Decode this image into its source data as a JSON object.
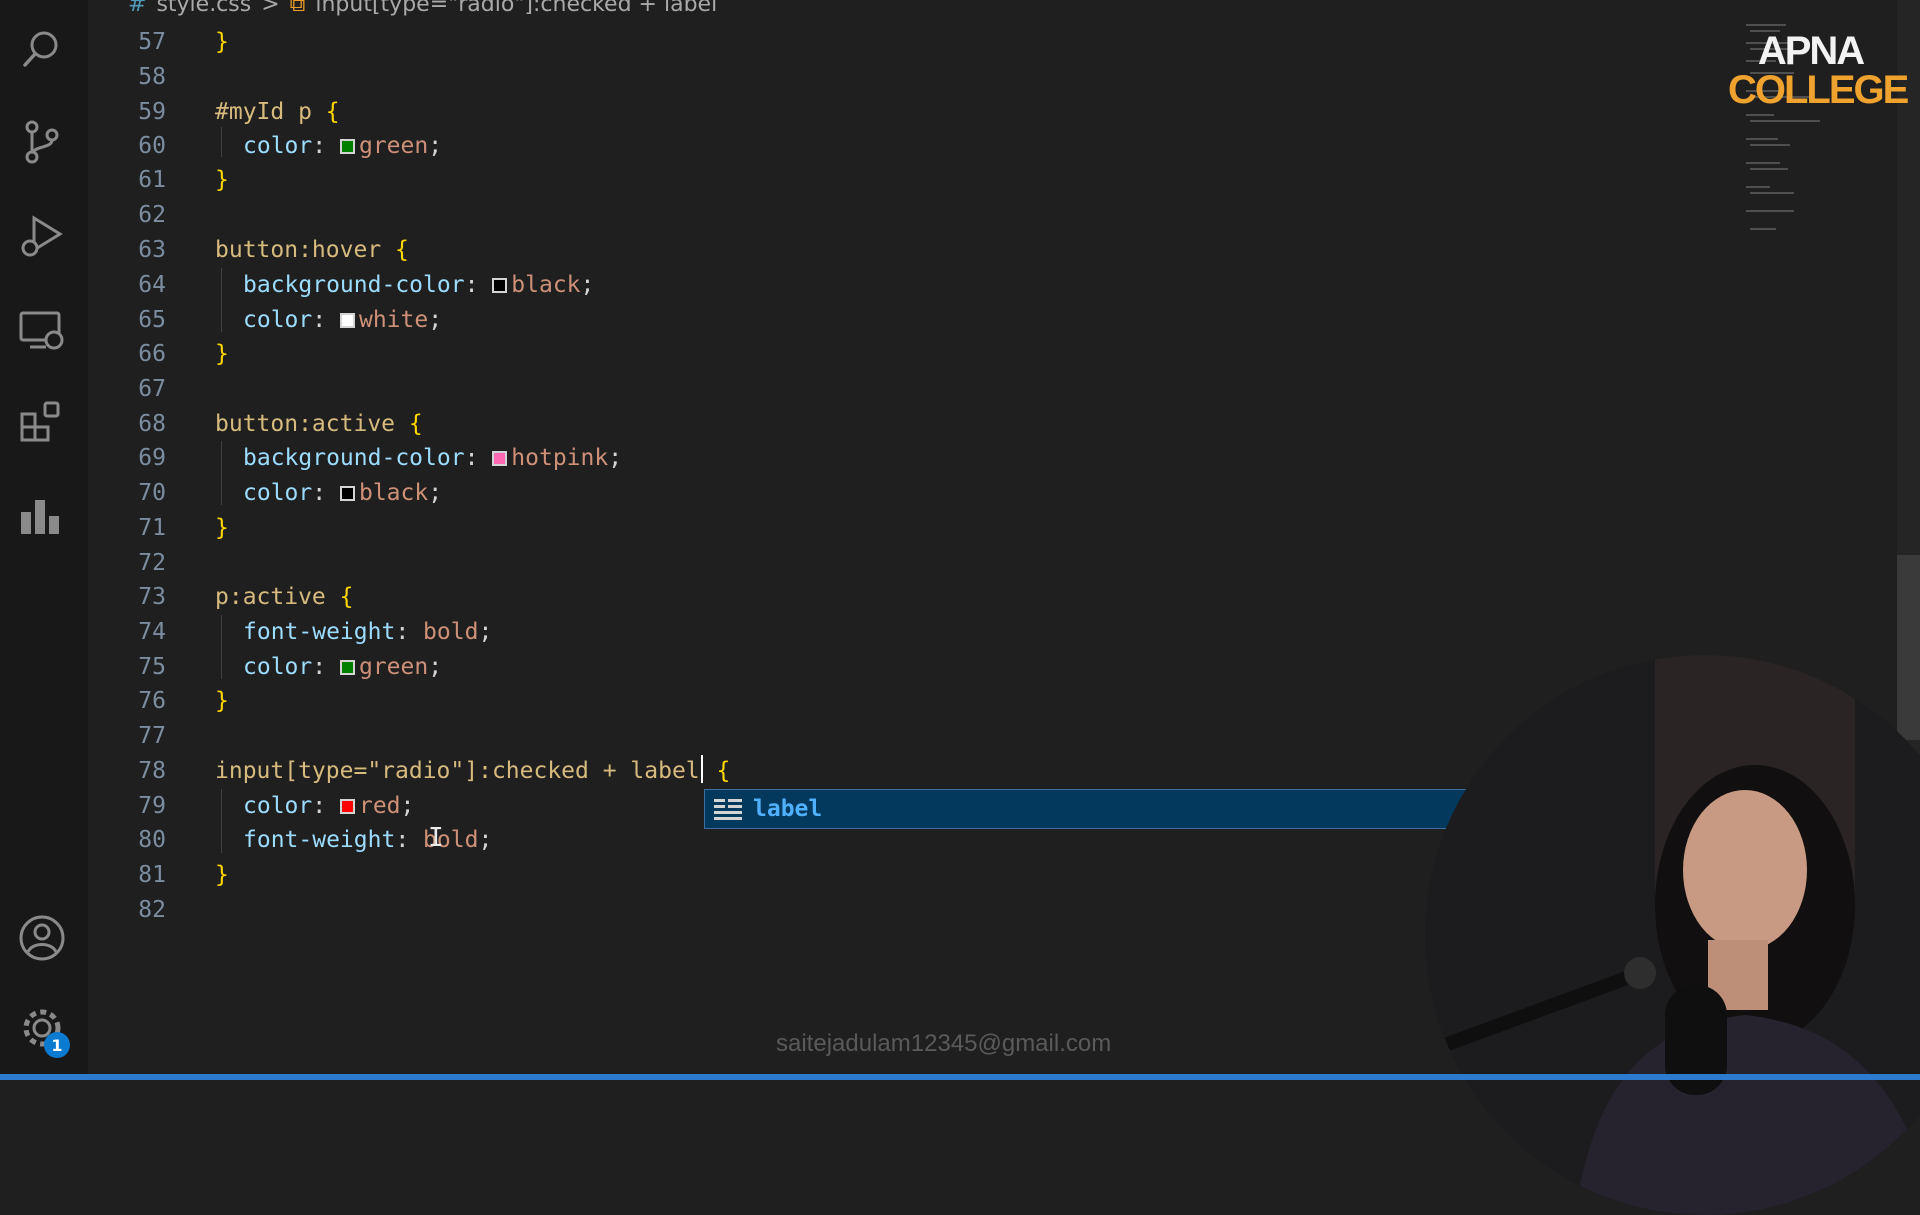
{
  "breadcrumb": {
    "file_icon": "#",
    "file": "style.css",
    "separator": ">",
    "symbol_icon": "selector-icon",
    "symbol": "input[type=\"radio\"]:checked + label"
  },
  "activity_bar": {
    "items": [
      "search-icon",
      "source-control-icon",
      "run-debug-icon",
      "remote-explorer-icon",
      "extensions-icon",
      "charts-icon"
    ],
    "bottom": [
      "account-icon",
      "settings-gear-icon"
    ],
    "settings_badge": "1"
  },
  "editor": {
    "lines": [
      {
        "n": "57"
      },
      {
        "n": "58"
      },
      {
        "n": "59"
      },
      {
        "n": "60"
      },
      {
        "n": "61"
      },
      {
        "n": "62"
      },
      {
        "n": "63"
      },
      {
        "n": "64"
      },
      {
        "n": "65"
      },
      {
        "n": "66"
      },
      {
        "n": "67"
      },
      {
        "n": "68"
      },
      {
        "n": "69"
      },
      {
        "n": "70"
      },
      {
        "n": "71"
      },
      {
        "n": "72"
      },
      {
        "n": "73"
      },
      {
        "n": "74"
      },
      {
        "n": "75"
      },
      {
        "n": "76"
      },
      {
        "n": "77"
      },
      {
        "n": "78"
      },
      {
        "n": "79"
      },
      {
        "n": "80"
      },
      {
        "n": "81"
      },
      {
        "n": "82"
      }
    ],
    "code": {
      "close_brace": "}",
      "open_brace": "{",
      "l59_sel": "#myId p",
      "l63_sel": "button:hover",
      "l68_sel": "button:active",
      "l73_sel": "p:active",
      "l78_sel": "input[type=\"radio\"]:checked + label",
      "prop_color": "color",
      "prop_bg": "background-color",
      "prop_fw": "font-weight",
      "colon": ":",
      "semi": ";",
      "v_green": "green",
      "v_black": "black",
      "v_white": "white",
      "v_hotpink": "hotpink",
      "v_bold": "bold",
      "v_red": "red"
    },
    "swatch_colors": {
      "green": "#008000",
      "black": "#000000",
      "white": "#ffffff",
      "hotpink": "#ff69b4",
      "red": "#ff0000"
    }
  },
  "suggestion": {
    "icon": "text-symbol-icon",
    "label": "label"
  },
  "logo": {
    "line1": "APNA",
    "line2": "COLLEGE"
  },
  "watermark_email": "saitejadulam12345@gmail.com",
  "colors": {
    "accent": "#2b7bd1",
    "selection": "#04395e",
    "logo_orange": "#f0a22e"
  }
}
